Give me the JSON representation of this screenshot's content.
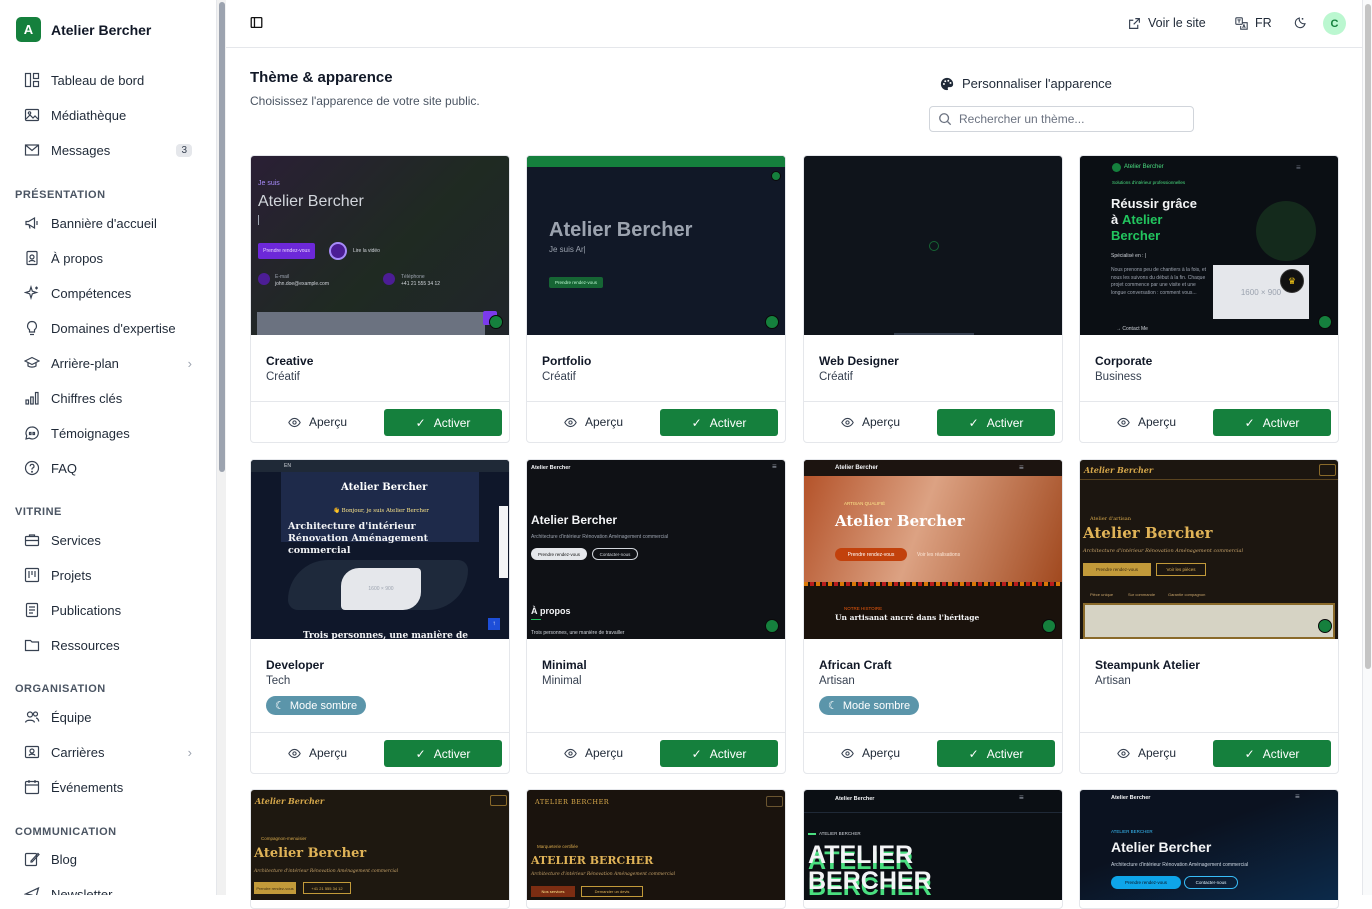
{
  "brand": {
    "letter": "A",
    "name": "Atelier Bercher"
  },
  "nav": {
    "top": [
      {
        "label": "Tableau de bord"
      },
      {
        "label": "Médiathèque"
      },
      {
        "label": "Messages",
        "badge": "3"
      }
    ],
    "sections": [
      {
        "title": "PRÉSENTATION",
        "items": [
          "Bannière d'accueil",
          "À propos",
          "Compétences",
          "Domaines d'expertise",
          "Arrière-plan",
          "Chiffres clés",
          "Témoignages",
          "FAQ"
        ]
      },
      {
        "title": "VITRINE",
        "items": [
          "Services",
          "Projets",
          "Publications",
          "Ressources"
        ]
      },
      {
        "title": "ORGANISATION",
        "items": [
          "Équipe",
          "Carrières",
          "Événements"
        ]
      },
      {
        "title": "COMMUNICATION",
        "items": [
          "Blog",
          "Newsletter"
        ]
      }
    ]
  },
  "topbar": {
    "view_site": "Voir le site",
    "lang": "FR",
    "avatar": "C"
  },
  "page": {
    "title": "Thème & apparence",
    "subtitle": "Choisissez l'apparence de votre site public.",
    "customize": "Personnaliser l'apparence",
    "search_placeholder": "Rechercher un thème..."
  },
  "labels": {
    "preview": "Aperçu",
    "activate": "Activer",
    "dark_mode": "Mode sombre"
  },
  "themes": [
    {
      "name": "Creative",
      "category": "Créatif"
    },
    {
      "name": "Portfolio",
      "category": "Créatif"
    },
    {
      "name": "Web Designer",
      "category": "Créatif"
    },
    {
      "name": "Corporate",
      "category": "Business"
    },
    {
      "name": "Developer",
      "category": "Tech",
      "dark_mode": true
    },
    {
      "name": "Minimal",
      "category": "Minimal"
    },
    {
      "name": "African Craft",
      "category": "Artisan",
      "dark_mode": true
    },
    {
      "name": "Steampunk Atelier",
      "category": "Artisan"
    }
  ],
  "previews": {
    "creative": {
      "kicker": "Je suis",
      "title": "Atelier Bercher",
      "cta": "Prendre rendez-vous",
      "video": "Lire la vidéo",
      "email_label": "E-mail",
      "email": "john.doe@example.com",
      "phone_label": "Téléphone",
      "phone": "+41 21 555 34 12"
    },
    "portfolio": {
      "title": "Atelier Bercher",
      "sub": "Je suis Ar|",
      "cta": "Prendre rendez-vous"
    },
    "corporate": {
      "brand": "Atelier Bercher",
      "tag": "Solutions d'intérieur professionnelles",
      "h1": "Réussir grâce",
      "h2": "à",
      "h3": "Atelier",
      "h4": "Bercher",
      "spec": "Spécialisé en : |",
      "body": "Nous prenons peu de chantiers à la fois, et nous les suivons du début à la fin. Chaque projet commence par une visite et une longue conversation : comment vous...",
      "img": "1600 × 900",
      "contact": "→ Contact Me"
    },
    "developer": {
      "title": "Atelier Bercher",
      "hello": "👋 Bonjour, je suis Atelier Bercher",
      "h": "Architecture d'intérieur Rénovation Aménagement commercial",
      "img": "1600 × 900",
      "foot": "Trois personnes, une manière de",
      "lang": "EN"
    },
    "minimal": {
      "brand": "Atelier Bercher",
      "title": "Atelier Bercher",
      "sub": "Architecture d'intérieur Rénovation Aménagement commercial",
      "cta1": "Prendre rendez-vous",
      "cta2": "Contacter-nous",
      "about": "À propos",
      "about_text": "Trois personnes, une manière de travailler"
    },
    "african": {
      "brand": "Atelier Bercher",
      "kicker": "ARTISAN QUALIFIÉ",
      "title": "Atelier Bercher",
      "cta1": "Prendre rendez-vous",
      "cta2": "Voir les réalisations",
      "story": "NOTRE HISTOIRE",
      "h": "Un artisanat ancré dans l'héritage"
    },
    "steampunk": {
      "brand": "Atelier Bercher",
      "kicker": "Atelier d'artisan",
      "title": "Atelier Bercher",
      "sub": "Architecture d'intérieur Rénovation Aménagement commercial",
      "cta1": "Prendre rendez-vous",
      "cta2": "Voir les pièces",
      "f1": "Pièce unique",
      "f2": "Sur commande",
      "f3": "Garantie compagnon"
    },
    "r3a": {
      "brand": "Atelier Bercher",
      "kicker": "Compagnon-menuisier",
      "title": "Atelier Bercher",
      "sub": "Architecture d'intérieur Rénovation Aménagement commercial",
      "cta": "Prendre rendez-vous",
      "phone": "+41 21 555 34 12"
    },
    "r3b": {
      "brand": "ATELIER BERCHER",
      "kicker": "Marqueterie certifiée",
      "title": "ATELIER BERCHER",
      "sub": "Architecture d'intérieur Rénovation Aménagement commercial",
      "cta1": "Nos services",
      "cta2": "Demander un devis"
    },
    "r3c": {
      "brand": "Atelier Bercher",
      "kicker": "ATELIER BERCHER",
      "l1": "ATELIER",
      "l2": "BERCHER"
    },
    "r3d": {
      "brand": "Atelier Bercher",
      "kicker": "ATELIER BERCHER",
      "title": "Atelier Bercher",
      "sub": "Architecture d'intérieur Rénovation Aménagement commercial",
      "cta1": "Prendre rendez-vous",
      "cta2": "Contacter-nous"
    }
  }
}
